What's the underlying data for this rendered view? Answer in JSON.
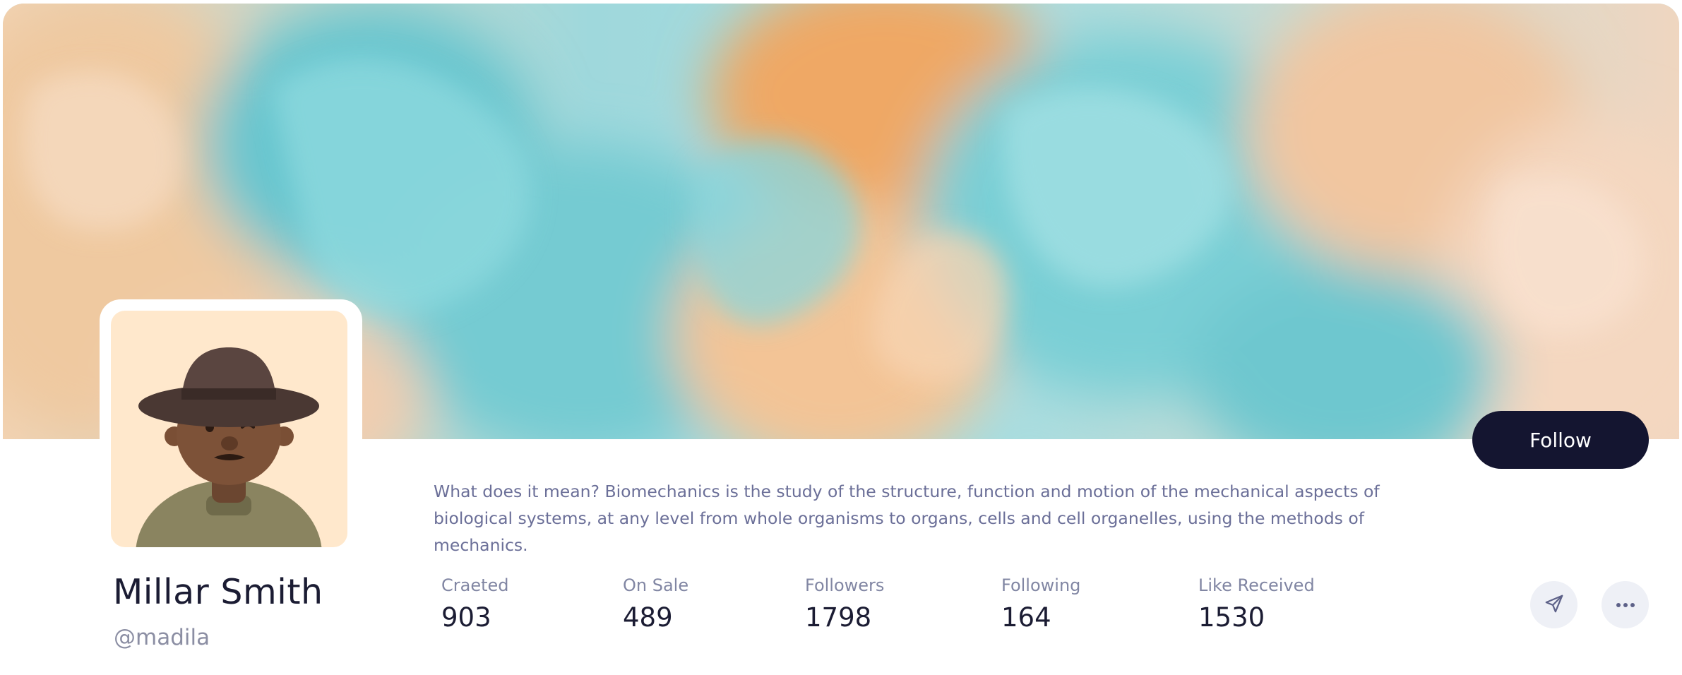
{
  "profile": {
    "name": "Millar Smith",
    "handle": "@madila",
    "bio": "What does it mean? Biomechanics is the study of the structure, function and motion of the mechanical aspects of biological systems, at any level from whole organisms to organs, cells and cell organelles, using the methods of mechanics.",
    "avatar_icon": "avatar-cowboy-hat"
  },
  "actions": {
    "follow_label": "Follow",
    "send_icon": "send-icon",
    "more_icon": "more-icon"
  },
  "stats": [
    {
      "label": "Craeted",
      "value": "903"
    },
    {
      "label": "On Sale",
      "value": "489"
    },
    {
      "label": "Followers",
      "value": "1798"
    },
    {
      "label": "Following",
      "value": "164"
    },
    {
      "label": "Like Received",
      "value": "1530"
    }
  ],
  "colors": {
    "button_dark": "#141530",
    "name_text": "#1b1c33",
    "muted_text": "#8b8ea3",
    "bio_text": "#6b6f98",
    "banner_teal": "#7ccfd4",
    "banner_orange": "#f0b87a"
  }
}
